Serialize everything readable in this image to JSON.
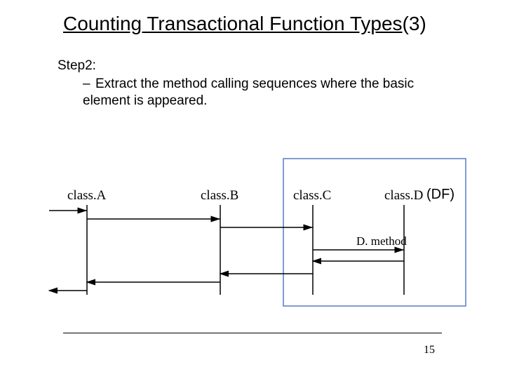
{
  "title": {
    "underlined": "Counting Transactional Function Types",
    "suffix": "(3)"
  },
  "step_label": "Step2:",
  "bullet_text": "Extract the method calling sequences where the basic element is appeared.",
  "diagram": {
    "classA": "class.A",
    "classB": "class.B",
    "classC": "class.C",
    "classD": "class.D",
    "df": "(DF)",
    "method": "D. method"
  },
  "page_number": "15"
}
